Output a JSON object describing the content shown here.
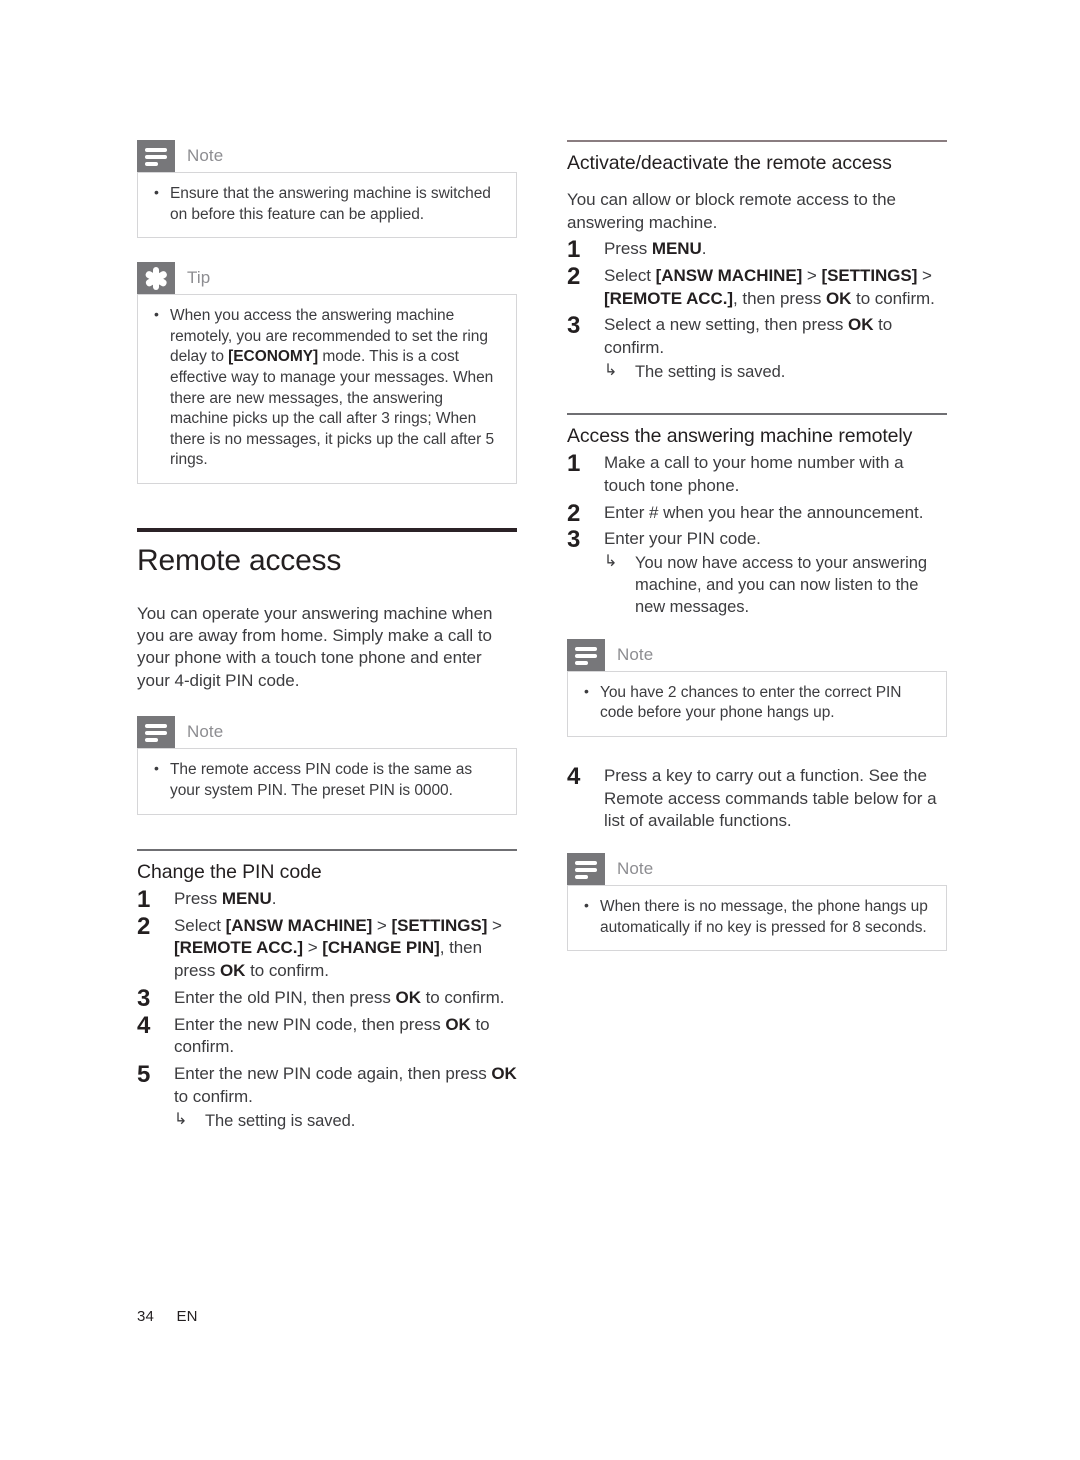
{
  "page": {
    "number": "34",
    "language": "EN"
  },
  "left_column": {
    "note_top": {
      "icon": "note-icon",
      "label": "Note",
      "items": [
        "Ensure that the answering machine is switched on before this feature can be applied."
      ]
    },
    "tip": {
      "icon": "tip-icon",
      "label": "Tip",
      "items": [
        "When you access the answering machine remotely, you are recommended to set the ring delay to [ECONOMY] mode. This is a cost effective way to manage your messages. When there are new messages, the answering machine picks up the call after 3 rings; When there is no messages, it picks up the call after 5 rings."
      ]
    },
    "section": {
      "title": "Remote access",
      "intro": "You can operate your answering machine when you are away from home. Simply make a call to your phone with a touch tone phone and enter your 4-digit PIN code."
    },
    "note_pin": {
      "icon": "note-icon",
      "label": "Note",
      "items": [
        "The remote access PIN code is the same as your system PIN. The preset PIN is 0000."
      ]
    },
    "change_pin": {
      "heading": "Change the PIN code",
      "steps": [
        {
          "num": "1",
          "parts": [
            {
              "text": "Press ",
              "bold": false
            },
            {
              "text": "MENU",
              "bold": true
            },
            {
              "text": ".",
              "bold": false
            }
          ]
        },
        {
          "num": "2",
          "parts": [
            {
              "text": "Select ",
              "bold": false
            },
            {
              "text": "[ANSW MACHINE]",
              "bold": true
            },
            {
              "text": " > ",
              "bold": false
            },
            {
              "text": "[SETTINGS]",
              "bold": true
            },
            {
              "text": " > ",
              "bold": false
            },
            {
              "text": "[REMOTE ACC.]",
              "bold": true
            },
            {
              "text": " > ",
              "bold": false
            },
            {
              "text": "[CHANGE PIN]",
              "bold": true
            },
            {
              "text": ", then press ",
              "bold": false
            },
            {
              "text": "OK",
              "bold": true
            },
            {
              "text": " to confirm.",
              "bold": false
            }
          ]
        },
        {
          "num": "3",
          "parts": [
            {
              "text": "Enter the old PIN, then press ",
              "bold": false
            },
            {
              "text": "OK",
              "bold": true
            },
            {
              "text": " to confirm.",
              "bold": false
            }
          ]
        },
        {
          "num": "4",
          "parts": [
            {
              "text": "Enter the new PIN code, then press ",
              "bold": false
            },
            {
              "text": "OK",
              "bold": true
            },
            {
              "text": " to confirm.",
              "bold": false
            }
          ]
        },
        {
          "num": "5",
          "parts": [
            {
              "text": "Enter the new PIN code again, then press ",
              "bold": false
            },
            {
              "text": "OK",
              "bold": true
            },
            {
              "text": " to confirm.",
              "bold": false
            }
          ],
          "result": "The setting is saved."
        }
      ]
    }
  },
  "right_column": {
    "activate": {
      "heading": "Activate/deactivate the remote access",
      "intro": "You can allow or block remote access to the answering machine.",
      "steps": [
        {
          "num": "1",
          "parts": [
            {
              "text": "Press ",
              "bold": false
            },
            {
              "text": "MENU",
              "bold": true
            },
            {
              "text": ".",
              "bold": false
            }
          ]
        },
        {
          "num": "2",
          "parts": [
            {
              "text": "Select ",
              "bold": false
            },
            {
              "text": "[ANSW MACHINE]",
              "bold": true
            },
            {
              "text": " > ",
              "bold": false
            },
            {
              "text": "[SETTINGS]",
              "bold": true
            },
            {
              "text": " > ",
              "bold": false
            },
            {
              "text": "[REMOTE ACC.]",
              "bold": true
            },
            {
              "text": ", then press ",
              "bold": false
            },
            {
              "text": "OK",
              "bold": true
            },
            {
              "text": " to confirm.",
              "bold": false
            }
          ]
        },
        {
          "num": "3",
          "parts": [
            {
              "text": "Select a new setting, then press ",
              "bold": false
            },
            {
              "text": "OK",
              "bold": true
            },
            {
              "text": " to confirm.",
              "bold": false
            }
          ],
          "result": "The setting is saved."
        }
      ]
    },
    "access": {
      "heading": "Access the answering machine remotely",
      "steps": [
        {
          "num": "1",
          "parts": [
            {
              "text": "Make a call to your home number with a touch tone phone.",
              "bold": false
            }
          ]
        },
        {
          "num": "2",
          "parts": [
            {
              "text": "Enter # when you hear the announcement.",
              "bold": false
            }
          ]
        },
        {
          "num": "3",
          "parts": [
            {
              "text": "Enter your PIN code.",
              "bold": false
            }
          ],
          "result": "You now have access to your answering machine, and you can now listen to the new messages."
        }
      ],
      "note_pin_chances": {
        "icon": "note-icon",
        "label": "Note",
        "items": [
          "You have 2 chances to enter the correct PIN code before your phone hangs up."
        ]
      },
      "step4": {
        "num": "4",
        "parts": [
          {
            "text": "Press a key to carry out a function. See the Remote access commands table below for a list of available functions.",
            "bold": false
          }
        ]
      },
      "note_hangup": {
        "icon": "note-icon",
        "label": "Note",
        "items": [
          "When there is no message, the phone hangs up automatically if no key is pressed for 8 seconds."
        ]
      }
    }
  },
  "colors": {
    "text": "#231f20",
    "body_text": "#3c3c3f",
    "badge_gray": "#77777a",
    "label_gray": "#8d8d91",
    "box_border": "#d6d6d8",
    "rule_major": "#2b2226",
    "rule_minor": "#6f6f73"
  }
}
